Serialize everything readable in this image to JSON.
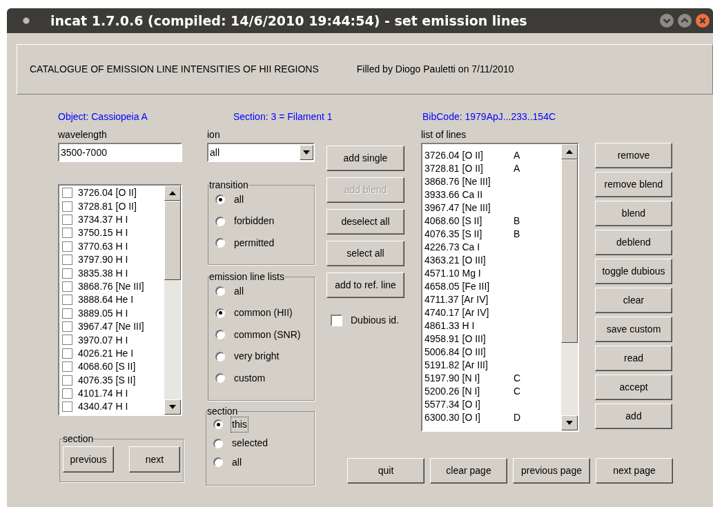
{
  "window": {
    "title": "incat 1.7.0.6 (compiled: 14/6/2010 19:44:54) - set emission lines"
  },
  "header": {
    "catalogue": "CATALOGUE OF EMISSION LINE INTENSITIES OF HII REGIONS",
    "filled_by": "Filled by Diogo Pauletti on 7/11/2010"
  },
  "info": {
    "object": "Object: Cassiopeia A",
    "section": "Section: 3 = Filament 1",
    "bibcode": "BibCode: 1979ApJ...233..154C"
  },
  "wavelength": {
    "label": "wavelength",
    "value": "3500-7000"
  },
  "ion": {
    "label": "ion",
    "value": "all"
  },
  "candidate_lines": [
    {
      "label": "3726.04 [O II]",
      "checked": false
    },
    {
      "label": "3728.81 [O II]",
      "checked": false
    },
    {
      "label": "3734.37 H I",
      "checked": false
    },
    {
      "label": "3750.15 H I",
      "checked": false
    },
    {
      "label": "3770.63 H I",
      "checked": false
    },
    {
      "label": "3797.90 H I",
      "checked": false
    },
    {
      "label": "3835.38 H I",
      "checked": false
    },
    {
      "label": "3868.76 [Ne III]",
      "checked": false
    },
    {
      "label": "3888.64 He I",
      "checked": false
    },
    {
      "label": "3889.05 H I",
      "checked": false
    },
    {
      "label": "3967.47 [Ne III]",
      "checked": false
    },
    {
      "label": "3970.07 H I",
      "checked": false
    },
    {
      "label": "4026.21 He I",
      "checked": false
    },
    {
      "label": "4068.60 [S II]",
      "checked": false
    },
    {
      "label": "4076.35 [S II]",
      "checked": false
    },
    {
      "label": "4101.74 H I",
      "checked": false
    },
    {
      "label": "4340.47 H I",
      "checked": false
    }
  ],
  "section_nav": {
    "title": "section",
    "buttons": [
      "previous",
      "next"
    ]
  },
  "transition": {
    "title": "transition",
    "options": [
      {
        "label": "all",
        "selected": true
      },
      {
        "label": "forbidden",
        "selected": false
      },
      {
        "label": "permitted",
        "selected": false
      }
    ]
  },
  "emission_line_lists": {
    "title": "emission line lists",
    "options": [
      {
        "label": "all",
        "selected": false
      },
      {
        "label": "common (HII)",
        "selected": true
      },
      {
        "label": "common (SNR)",
        "selected": false
      },
      {
        "label": "very bright",
        "selected": false
      },
      {
        "label": "custom",
        "selected": false
      }
    ]
  },
  "section_scope": {
    "title": "section",
    "options": [
      {
        "label": "this",
        "selected": true,
        "focused": true
      },
      {
        "label": "selected",
        "selected": false,
        "focused": false
      },
      {
        "label": "all",
        "selected": false,
        "focused": false
      }
    ]
  },
  "add_buttons": [
    {
      "label": "add single",
      "disabled": false
    },
    {
      "label": "add blend",
      "disabled": true
    },
    {
      "label": "deselect all",
      "disabled": false
    },
    {
      "label": "select all",
      "disabled": false
    },
    {
      "label": "add to ref. line",
      "disabled": false
    }
  ],
  "dubious": {
    "label": "Dubious id.",
    "checked": false
  },
  "list_of_lines": {
    "label": "list of lines",
    "rows": [
      {
        "line": "3726.04 [O II]",
        "group": "A"
      },
      {
        "line": "3728.81 [O II]",
        "group": "A"
      },
      {
        "line": "3868.76 [Ne III]"
      },
      {
        "line": "3933.66 Ca II"
      },
      {
        "line": "3967.47 [Ne III]"
      },
      {
        "line": "4068.60 [S II]",
        "group": "B"
      },
      {
        "line": "4076.35 [S II]",
        "group": "B"
      },
      {
        "line": "4226.73 Ca I"
      },
      {
        "line": "4363.21 [O III]"
      },
      {
        "line": "4571.10 Mg I"
      },
      {
        "line": "4658.05 [Fe III]"
      },
      {
        "line": "4711.37 [Ar IV]"
      },
      {
        "line": "4740.17 [Ar IV]"
      },
      {
        "line": "4861.33 H I"
      },
      {
        "line": "4958.91 [O III]"
      },
      {
        "line": "5006.84 [O III]"
      },
      {
        "line": "5191.82 [Ar III]"
      },
      {
        "line": "5197.90 [N I]",
        "group": "C"
      },
      {
        "line": "5200.26 [N I]",
        "group": "C"
      },
      {
        "line": "5577.34 [O I]"
      },
      {
        "line": "6300.30 [O I]",
        "group": "D"
      }
    ]
  },
  "actions": [
    "remove",
    "remove blend",
    "blend",
    "deblend",
    "toggle dubious",
    "clear",
    "save custom",
    "read",
    "accept",
    "add"
  ],
  "bottom_buttons": [
    "quit",
    "clear page",
    "previous page",
    "next page"
  ]
}
